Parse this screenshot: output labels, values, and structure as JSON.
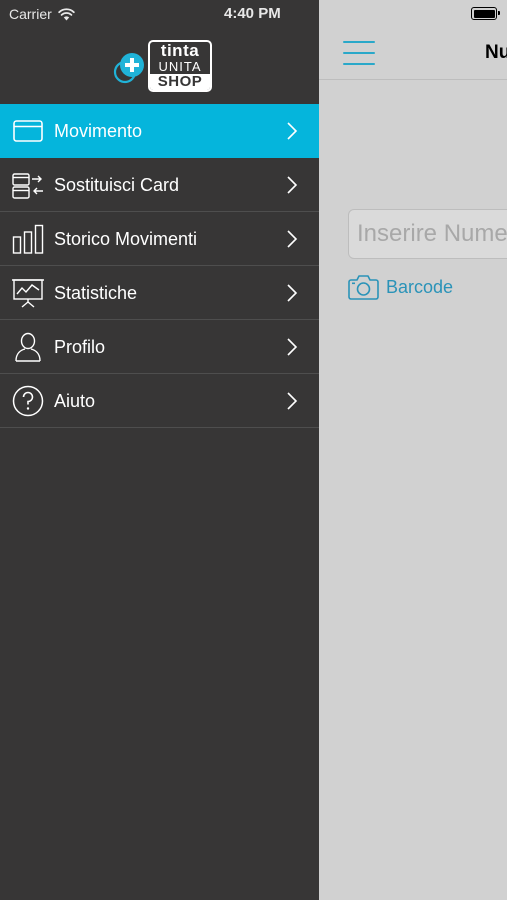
{
  "status_bar": {
    "carrier": "Carrier",
    "time": "4:40 PM"
  },
  "logo": {
    "line1": "tinta",
    "line2": "UNITA",
    "line3": "SHOP",
    "accent_color": "#20b3d8"
  },
  "menu": {
    "items": [
      {
        "label": "Movimento",
        "icon": "card-icon",
        "active": true
      },
      {
        "label": "Sostituisci Card",
        "icon": "swap-cards-icon",
        "active": false
      },
      {
        "label": "Storico Movimenti",
        "icon": "bar-chart-icon",
        "active": false
      },
      {
        "label": "Statistiche",
        "icon": "presentation-chart-icon",
        "active": false
      },
      {
        "label": "Profilo",
        "icon": "user-icon",
        "active": false
      },
      {
        "label": "Aiuto",
        "icon": "help-circle-icon",
        "active": false
      }
    ],
    "active_color": "#05b5dc",
    "background_color": "#373636"
  },
  "main": {
    "title": "Nu",
    "input_placeholder": "Inserire Nume",
    "barcode_label": "Barcode",
    "accent_color": "#2aa8c9"
  }
}
